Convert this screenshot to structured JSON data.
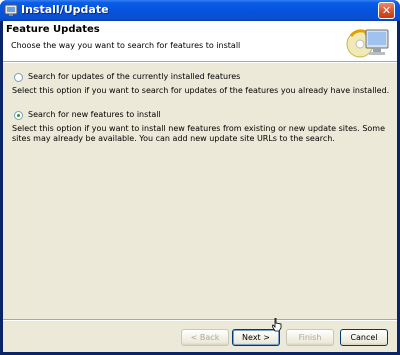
{
  "window": {
    "title": "Install/Update",
    "close_glyph": "✕",
    "icon": "install-update-icon"
  },
  "header": {
    "title": "Feature Updates",
    "description": "Choose the way you want to search for features to install",
    "banner_icon": "cd-monitor-update-icon"
  },
  "options": [
    {
      "label": "Search for updates of the currently installed features",
      "description": "Select this option if you want to search for updates of the features you already have installed.",
      "selected": false
    },
    {
      "label": "Search for new features to install",
      "description": "Select this option if you want to install new features from existing or new update sites. Some sites may already be available. You can add new update site URLs to the search.",
      "selected": true
    }
  ],
  "buttons": {
    "back": "< Back",
    "next": "Next >",
    "finish": "Finish",
    "cancel": "Cancel"
  },
  "colors": {
    "titlebar": "#0553de",
    "dialog_bg": "#ece9d8",
    "header_bg": "#ffffff",
    "radio_dot": "#21a121"
  }
}
